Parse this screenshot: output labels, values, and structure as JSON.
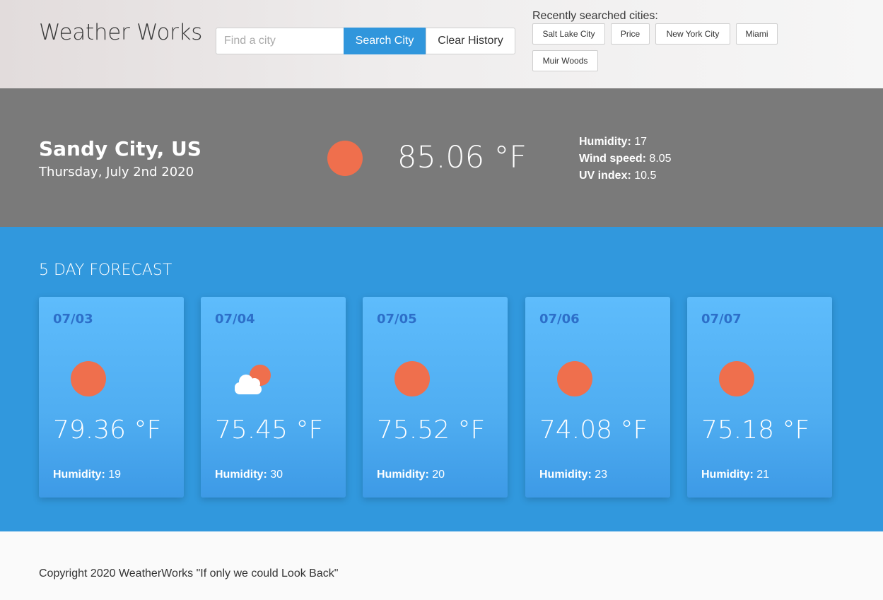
{
  "app": {
    "title": "Weather Works"
  },
  "search": {
    "placeholder": "Find a city",
    "value": "",
    "search_label": "Search City",
    "clear_label": "Clear History"
  },
  "recent": {
    "label": "Recently searched cities:",
    "cities": [
      "Salt Lake City",
      "Price",
      "New York City",
      "Miami",
      "Muir Woods"
    ]
  },
  "current": {
    "city": "Sandy City, US",
    "date": "Thursday, July 2nd 2020",
    "icon": "sun-icon",
    "temp": "85.06 °F",
    "humidity_label": "Humidity:",
    "humidity": "17",
    "wind_label": "Wind speed:",
    "wind": "8.05",
    "uv_label": "UV index:",
    "uv": "10.5"
  },
  "forecast": {
    "title": "5 DAY FORECAST",
    "humidity_label": "Humidity:",
    "days": [
      {
        "date": "07/03",
        "icon": "sun-icon",
        "temp": "79.36 °F",
        "humidity": "19"
      },
      {
        "date": "07/04",
        "icon": "partly-cloudy-icon",
        "temp": "75.45 °F",
        "humidity": "30"
      },
      {
        "date": "07/05",
        "icon": "sun-icon",
        "temp": "75.52 °F",
        "humidity": "20"
      },
      {
        "date": "07/06",
        "icon": "sun-icon",
        "temp": "74.08 °F",
        "humidity": "23"
      },
      {
        "date": "07/07",
        "icon": "sun-icon",
        "temp": "75.18 °F",
        "humidity": "21"
      }
    ]
  },
  "footer": {
    "copyright": "Copyright 2020 WeatherWorks \"If only we could Look Back\""
  },
  "colors": {
    "sun": "#ef6f4d",
    "accent": "#3096dc",
    "current_bg": "#7a7a7a",
    "forecast_bg": "#3198dd",
    "card_date": "#2d6fc9"
  }
}
